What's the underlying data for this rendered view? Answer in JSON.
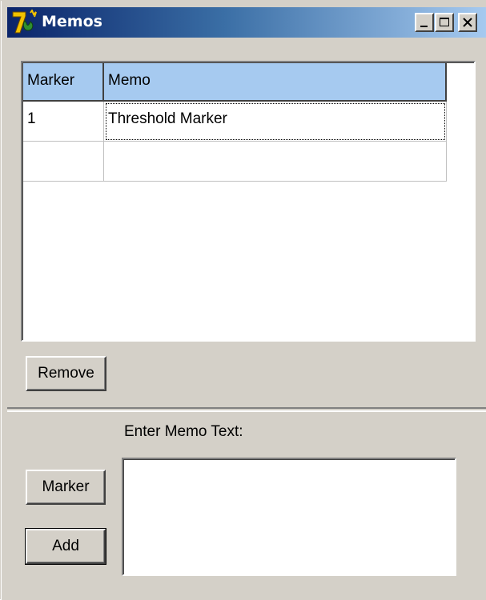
{
  "window": {
    "title": "Memos",
    "icon": "app-7-icon",
    "controls": {
      "minimize_icon": "minimize-icon",
      "maximize_icon": "maximize-icon",
      "close_icon": "close-icon"
    }
  },
  "grid": {
    "columns": [
      "Marker",
      "Memo"
    ],
    "rows": [
      {
        "marker": "1",
        "memo": "Threshold Marker"
      },
      {
        "marker": "",
        "memo": ""
      }
    ]
  },
  "buttons": {
    "remove": "Remove",
    "marker": "Marker",
    "add": "Add"
  },
  "memo_entry": {
    "label": "Enter Memo Text:",
    "value": ""
  },
  "colors": {
    "titlebar_start": "#0a246a",
    "titlebar_end": "#a6caf0",
    "header_bg": "#a6caf0",
    "face": "#d4d0c8"
  }
}
